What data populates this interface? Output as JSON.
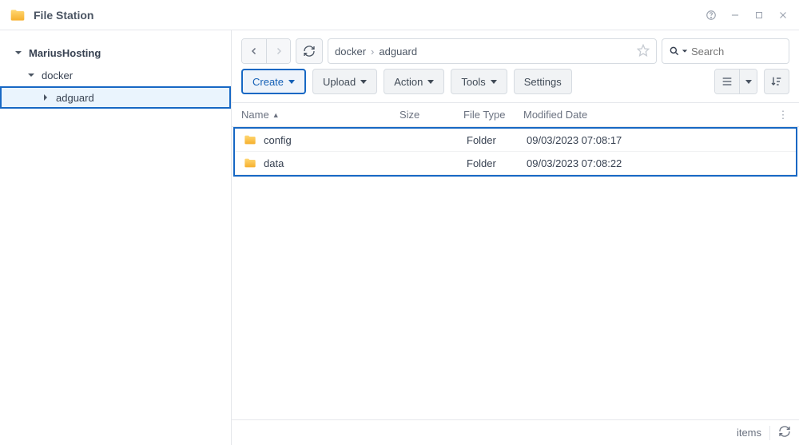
{
  "app": {
    "title": "File Station"
  },
  "sidebar": {
    "root": "MariusHosting",
    "items": [
      {
        "label": "docker"
      },
      {
        "label": "adguard"
      }
    ]
  },
  "breadcrumb": [
    "docker",
    "adguard"
  ],
  "search": {
    "placeholder": "Search"
  },
  "toolbar": {
    "create": "Create",
    "upload": "Upload",
    "action": "Action",
    "tools": "Tools",
    "settings": "Settings"
  },
  "columns": {
    "name": "Name",
    "size": "Size",
    "type": "File Type",
    "date": "Modified Date"
  },
  "rows": [
    {
      "name": "config",
      "size": "",
      "type": "Folder",
      "date": "09/03/2023 07:08:17"
    },
    {
      "name": "data",
      "size": "",
      "type": "Folder",
      "date": "09/03/2023 07:08:22"
    }
  ],
  "status": {
    "items_label": "items"
  }
}
